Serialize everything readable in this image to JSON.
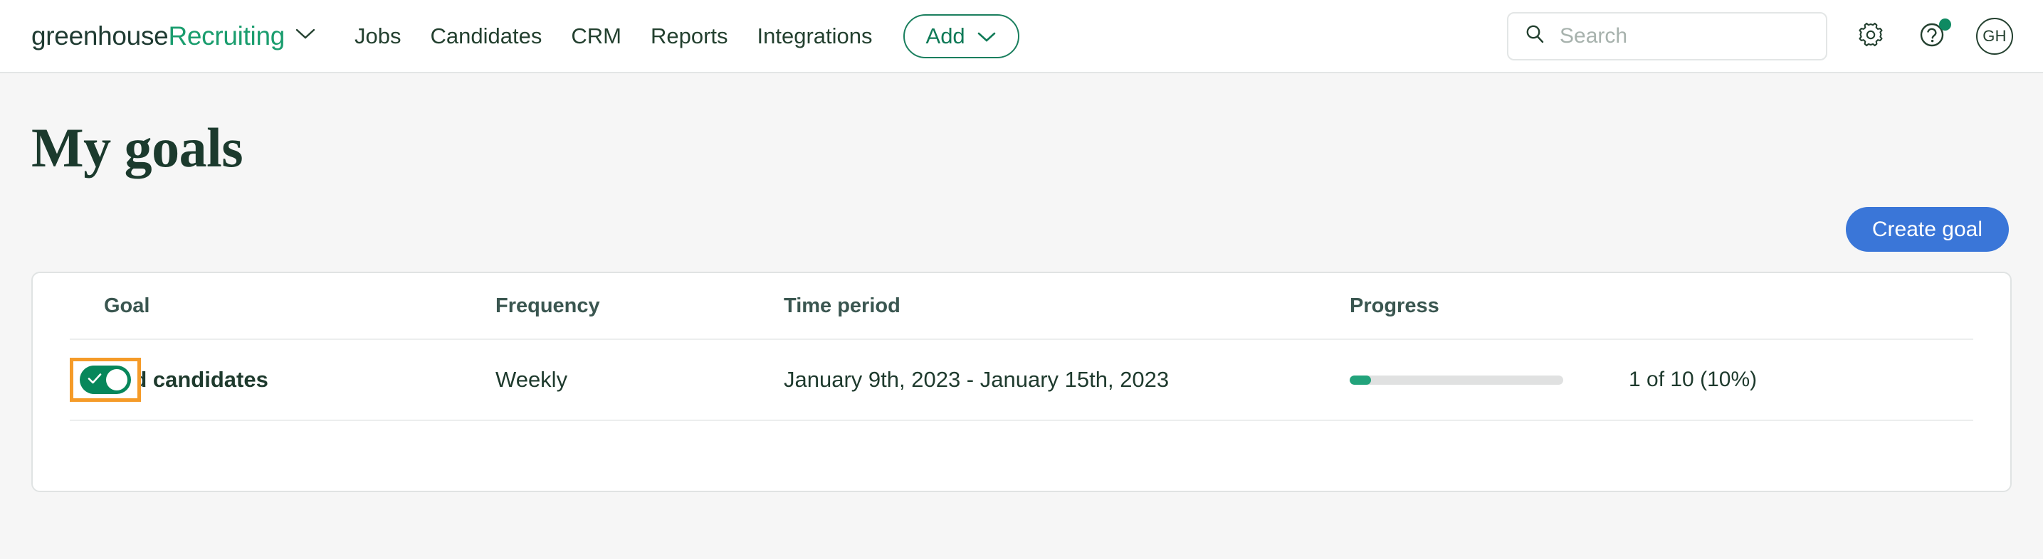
{
  "navbar": {
    "brand": {
      "word_dark": "greenhouse",
      "word_green": "Recruiting",
      "chevron_icon": "chevron-down-icon"
    },
    "links": [
      {
        "label": "Jobs"
      },
      {
        "label": "Candidates"
      },
      {
        "label": "CRM"
      },
      {
        "label": "Reports"
      },
      {
        "label": "Integrations"
      }
    ],
    "add_button": {
      "label": "Add",
      "chevron_icon": "chevron-down-icon"
    },
    "search": {
      "placeholder": "Search",
      "value": "",
      "icon": "search-icon"
    },
    "settings_icon": "gear-icon",
    "help_icon": "help-circle-icon",
    "help_has_notification": true,
    "avatar": {
      "initials": "GH"
    }
  },
  "page": {
    "title": "My goals",
    "create_goal_label": "Create goal"
  },
  "table": {
    "headers": {
      "goal": "Goal",
      "frequency": "Frequency",
      "time_period": "Time period",
      "progress": "Progress"
    },
    "rows": [
      {
        "toggle_enabled": true,
        "toggle_icon": "check-icon",
        "goal": "Add candidates",
        "frequency": "Weekly",
        "time_period": "January 9th, 2023 - January 15th, 2023",
        "progress_percent": 10,
        "progress_label": "1 of 10 (10%)"
      }
    ]
  },
  "colors": {
    "brand_green": "#1a9d6e",
    "dark_green": "#1e3a2d",
    "accent_blue": "#3a76d8",
    "focus_orange": "#f59b28",
    "toggle_green": "#07875b",
    "progress_green": "#22a37b",
    "page_bg": "#f6f6f6"
  }
}
